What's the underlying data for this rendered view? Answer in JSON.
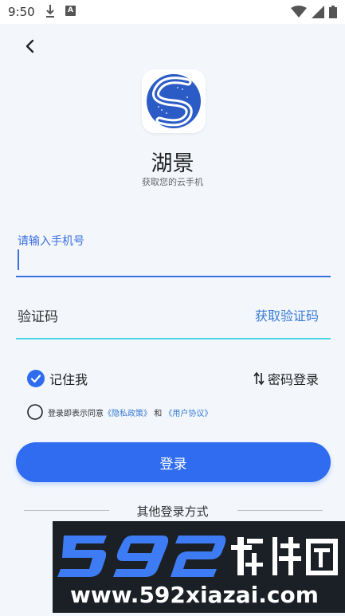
{
  "status_bar": {
    "time": "9:50",
    "a_icon_label": "A"
  },
  "app": {
    "name": "湖景",
    "subtitle": "获取您的云手机"
  },
  "phone": {
    "label": "请输入手机号",
    "value": "",
    "placeholder": ""
  },
  "code": {
    "label": "验证码",
    "get_code": "获取验证码"
  },
  "options": {
    "remember": "记住我",
    "remember_checked": true,
    "password_login": "密码登录"
  },
  "agreement": {
    "prefix": "登录即表示同意",
    "privacy": "《隐私政策》",
    "and": "和",
    "user": "《用户协议》",
    "checked": false
  },
  "login_button": "登录",
  "other_login": "其他登录方式",
  "watermark": {
    "brand": "592软件园",
    "url": "www.592xiazai.com"
  },
  "colors": {
    "accent": "#2f6cf0",
    "link": "#3a7bd5",
    "code_line": "#48d6e6",
    "background": "#f3f7fc"
  }
}
